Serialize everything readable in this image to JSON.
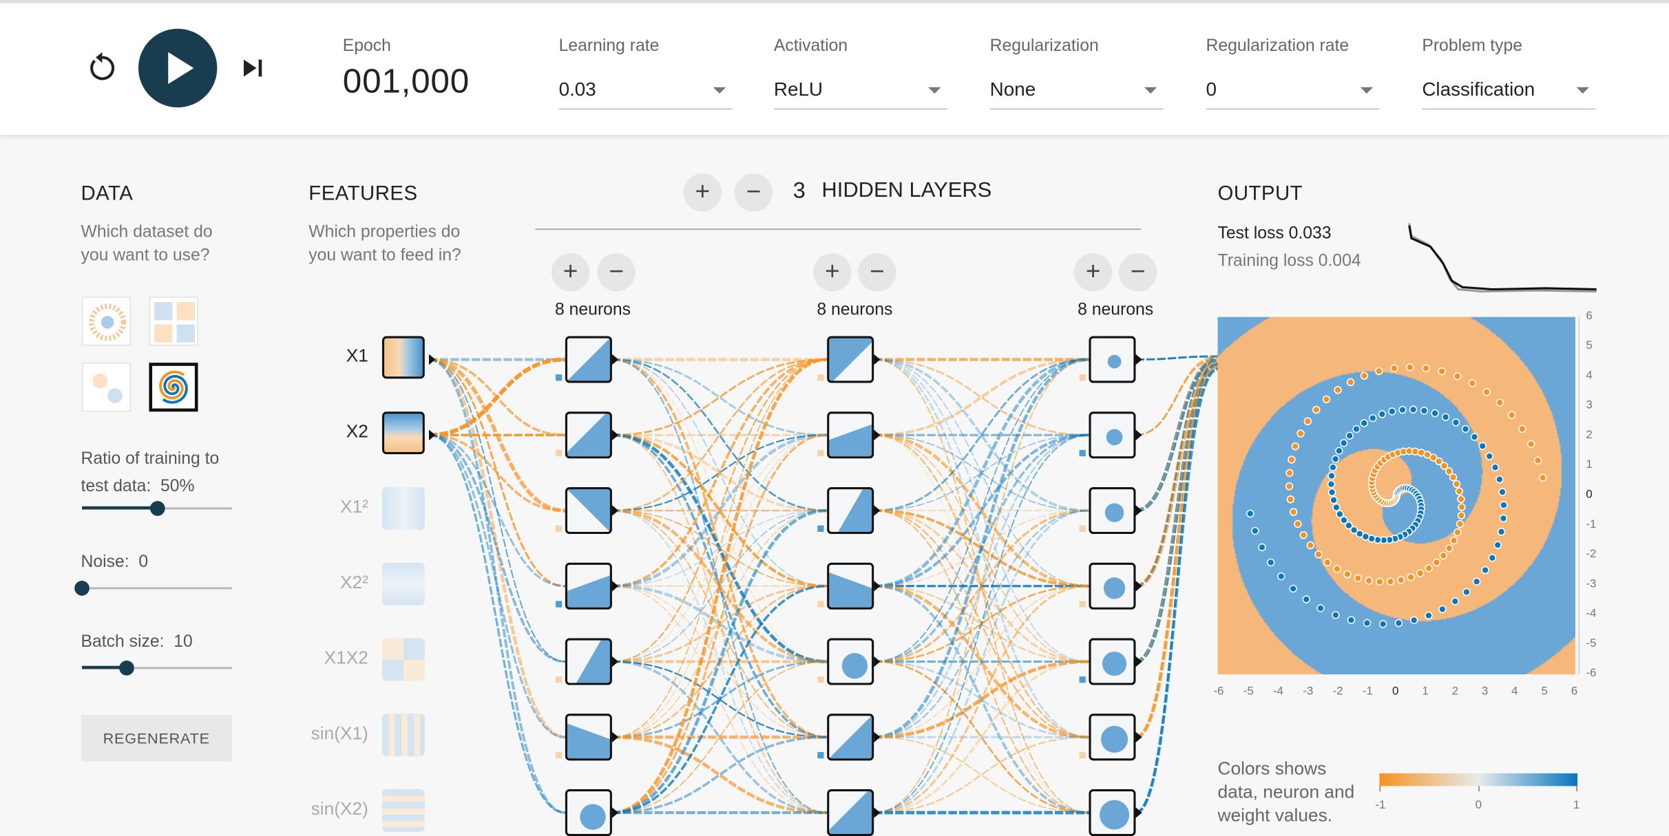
{
  "controls": {
    "epoch_label": "Epoch",
    "epoch_value": "001,000",
    "learning_rate": {
      "label": "Learning rate",
      "value": "0.03"
    },
    "activation": {
      "label": "Activation",
      "value": "ReLU"
    },
    "regularization": {
      "label": "Regularization",
      "value": "None"
    },
    "regularization_rate": {
      "label": "Regularization rate",
      "value": "0"
    },
    "problem_type": {
      "label": "Problem type",
      "value": "Classification"
    }
  },
  "data": {
    "title": "DATA",
    "subtitle": "Which dataset do you want to use?",
    "datasets": [
      {
        "name": "circle",
        "selected": false
      },
      {
        "name": "xor",
        "selected": false
      },
      {
        "name": "gaussian",
        "selected": false
      },
      {
        "name": "spiral",
        "selected": true
      }
    ],
    "ratio_label": "Ratio of training to test data:",
    "ratio_value": "50%",
    "ratio_fraction": 0.5,
    "noise_label": "Noise:",
    "noise_value": "0",
    "noise_fraction": 0.0,
    "batch_label": "Batch size:",
    "batch_value": "10",
    "batch_fraction": 0.3,
    "regenerate_label": "REGENERATE"
  },
  "features": {
    "title": "FEATURES",
    "subtitle": "Which properties do you want to feed in?",
    "items": [
      {
        "label": "X1",
        "active": true
      },
      {
        "label": "X2",
        "active": true
      },
      {
        "label": "X1²",
        "active": false
      },
      {
        "label": "X2²",
        "active": false
      },
      {
        "label": "X1X2",
        "active": false
      },
      {
        "label": "sin(X1)",
        "active": false
      },
      {
        "label": "sin(X2)",
        "active": false
      }
    ]
  },
  "network": {
    "hidden_layers_count": "3",
    "hidden_layers_label": "HIDDEN LAYERS",
    "layers": [
      {
        "neurons_label": "8 neurons"
      },
      {
        "neurons_label": "8 neurons"
      },
      {
        "neurons_label": "8 neurons"
      }
    ]
  },
  "output": {
    "title": "OUTPUT",
    "test_loss": "Test loss 0.033",
    "training_loss": "Training loss 0.004",
    "x_ticks": [
      "-6",
      "-5",
      "-4",
      "-3",
      "-2",
      "-1",
      "0",
      "1",
      "2",
      "3",
      "4",
      "5",
      "6"
    ],
    "y_ticks": [
      "6",
      "5",
      "4",
      "3",
      "2",
      "1",
      "0",
      "-1",
      "-2",
      "-3",
      "-4",
      "-5",
      "-6"
    ],
    "legend_text": "Colors shows data, neuron and weight values.",
    "legend_ticks": [
      "-1",
      "0",
      "1"
    ]
  },
  "colors": {
    "orange": "#f59322",
    "blue": "#0877bd",
    "dark": "#183d4e"
  }
}
